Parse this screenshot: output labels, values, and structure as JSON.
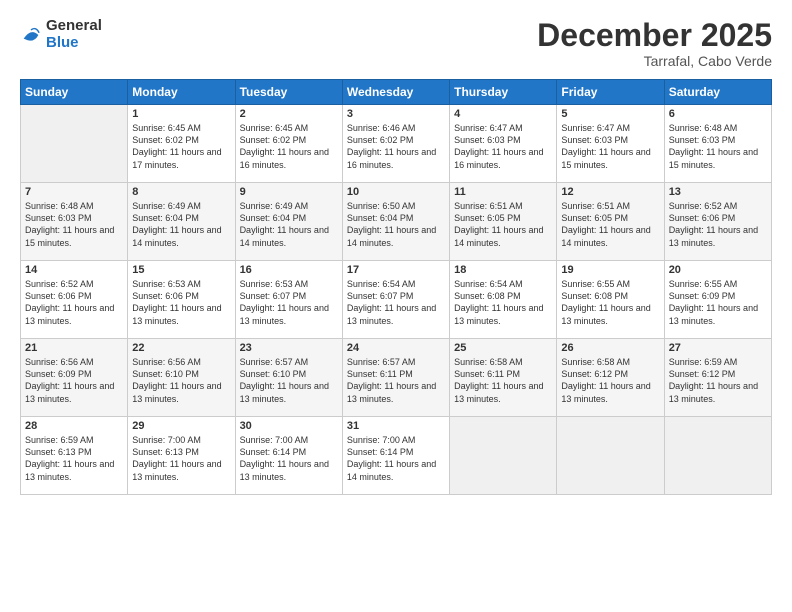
{
  "header": {
    "logo_general": "General",
    "logo_blue": "Blue",
    "month": "December 2025",
    "location": "Tarrafal, Cabo Verde"
  },
  "weekdays": [
    "Sunday",
    "Monday",
    "Tuesday",
    "Wednesday",
    "Thursday",
    "Friday",
    "Saturday"
  ],
  "weeks": [
    [
      {
        "day": "",
        "sunrise": "",
        "sunset": "",
        "daylight": ""
      },
      {
        "day": "1",
        "sunrise": "Sunrise: 6:45 AM",
        "sunset": "Sunset: 6:02 PM",
        "daylight": "Daylight: 11 hours and 17 minutes."
      },
      {
        "day": "2",
        "sunrise": "Sunrise: 6:45 AM",
        "sunset": "Sunset: 6:02 PM",
        "daylight": "Daylight: 11 hours and 16 minutes."
      },
      {
        "day": "3",
        "sunrise": "Sunrise: 6:46 AM",
        "sunset": "Sunset: 6:02 PM",
        "daylight": "Daylight: 11 hours and 16 minutes."
      },
      {
        "day": "4",
        "sunrise": "Sunrise: 6:47 AM",
        "sunset": "Sunset: 6:03 PM",
        "daylight": "Daylight: 11 hours and 16 minutes."
      },
      {
        "day": "5",
        "sunrise": "Sunrise: 6:47 AM",
        "sunset": "Sunset: 6:03 PM",
        "daylight": "Daylight: 11 hours and 15 minutes."
      },
      {
        "day": "6",
        "sunrise": "Sunrise: 6:48 AM",
        "sunset": "Sunset: 6:03 PM",
        "daylight": "Daylight: 11 hours and 15 minutes."
      }
    ],
    [
      {
        "day": "7",
        "sunrise": "Sunrise: 6:48 AM",
        "sunset": "Sunset: 6:03 PM",
        "daylight": "Daylight: 11 hours and 15 minutes."
      },
      {
        "day": "8",
        "sunrise": "Sunrise: 6:49 AM",
        "sunset": "Sunset: 6:04 PM",
        "daylight": "Daylight: 11 hours and 14 minutes."
      },
      {
        "day": "9",
        "sunrise": "Sunrise: 6:49 AM",
        "sunset": "Sunset: 6:04 PM",
        "daylight": "Daylight: 11 hours and 14 minutes."
      },
      {
        "day": "10",
        "sunrise": "Sunrise: 6:50 AM",
        "sunset": "Sunset: 6:04 PM",
        "daylight": "Daylight: 11 hours and 14 minutes."
      },
      {
        "day": "11",
        "sunrise": "Sunrise: 6:51 AM",
        "sunset": "Sunset: 6:05 PM",
        "daylight": "Daylight: 11 hours and 14 minutes."
      },
      {
        "day": "12",
        "sunrise": "Sunrise: 6:51 AM",
        "sunset": "Sunset: 6:05 PM",
        "daylight": "Daylight: 11 hours and 14 minutes."
      },
      {
        "day": "13",
        "sunrise": "Sunrise: 6:52 AM",
        "sunset": "Sunset: 6:06 PM",
        "daylight": "Daylight: 11 hours and 13 minutes."
      }
    ],
    [
      {
        "day": "14",
        "sunrise": "Sunrise: 6:52 AM",
        "sunset": "Sunset: 6:06 PM",
        "daylight": "Daylight: 11 hours and 13 minutes."
      },
      {
        "day": "15",
        "sunrise": "Sunrise: 6:53 AM",
        "sunset": "Sunset: 6:06 PM",
        "daylight": "Daylight: 11 hours and 13 minutes."
      },
      {
        "day": "16",
        "sunrise": "Sunrise: 6:53 AM",
        "sunset": "Sunset: 6:07 PM",
        "daylight": "Daylight: 11 hours and 13 minutes."
      },
      {
        "day": "17",
        "sunrise": "Sunrise: 6:54 AM",
        "sunset": "Sunset: 6:07 PM",
        "daylight": "Daylight: 11 hours and 13 minutes."
      },
      {
        "day": "18",
        "sunrise": "Sunrise: 6:54 AM",
        "sunset": "Sunset: 6:08 PM",
        "daylight": "Daylight: 11 hours and 13 minutes."
      },
      {
        "day": "19",
        "sunrise": "Sunrise: 6:55 AM",
        "sunset": "Sunset: 6:08 PM",
        "daylight": "Daylight: 11 hours and 13 minutes."
      },
      {
        "day": "20",
        "sunrise": "Sunrise: 6:55 AM",
        "sunset": "Sunset: 6:09 PM",
        "daylight": "Daylight: 11 hours and 13 minutes."
      }
    ],
    [
      {
        "day": "21",
        "sunrise": "Sunrise: 6:56 AM",
        "sunset": "Sunset: 6:09 PM",
        "daylight": "Daylight: 11 hours and 13 minutes."
      },
      {
        "day": "22",
        "sunrise": "Sunrise: 6:56 AM",
        "sunset": "Sunset: 6:10 PM",
        "daylight": "Daylight: 11 hours and 13 minutes."
      },
      {
        "day": "23",
        "sunrise": "Sunrise: 6:57 AM",
        "sunset": "Sunset: 6:10 PM",
        "daylight": "Daylight: 11 hours and 13 minutes."
      },
      {
        "day": "24",
        "sunrise": "Sunrise: 6:57 AM",
        "sunset": "Sunset: 6:11 PM",
        "daylight": "Daylight: 11 hours and 13 minutes."
      },
      {
        "day": "25",
        "sunrise": "Sunrise: 6:58 AM",
        "sunset": "Sunset: 6:11 PM",
        "daylight": "Daylight: 11 hours and 13 minutes."
      },
      {
        "day": "26",
        "sunrise": "Sunrise: 6:58 AM",
        "sunset": "Sunset: 6:12 PM",
        "daylight": "Daylight: 11 hours and 13 minutes."
      },
      {
        "day": "27",
        "sunrise": "Sunrise: 6:59 AM",
        "sunset": "Sunset: 6:12 PM",
        "daylight": "Daylight: 11 hours and 13 minutes."
      }
    ],
    [
      {
        "day": "28",
        "sunrise": "Sunrise: 6:59 AM",
        "sunset": "Sunset: 6:13 PM",
        "daylight": "Daylight: 11 hours and 13 minutes."
      },
      {
        "day": "29",
        "sunrise": "Sunrise: 7:00 AM",
        "sunset": "Sunset: 6:13 PM",
        "daylight": "Daylight: 11 hours and 13 minutes."
      },
      {
        "day": "30",
        "sunrise": "Sunrise: 7:00 AM",
        "sunset": "Sunset: 6:14 PM",
        "daylight": "Daylight: 11 hours and 13 minutes."
      },
      {
        "day": "31",
        "sunrise": "Sunrise: 7:00 AM",
        "sunset": "Sunset: 6:14 PM",
        "daylight": "Daylight: 11 hours and 14 minutes."
      },
      {
        "day": "",
        "sunrise": "",
        "sunset": "",
        "daylight": ""
      },
      {
        "day": "",
        "sunrise": "",
        "sunset": "",
        "daylight": ""
      },
      {
        "day": "",
        "sunrise": "",
        "sunset": "",
        "daylight": ""
      }
    ]
  ]
}
